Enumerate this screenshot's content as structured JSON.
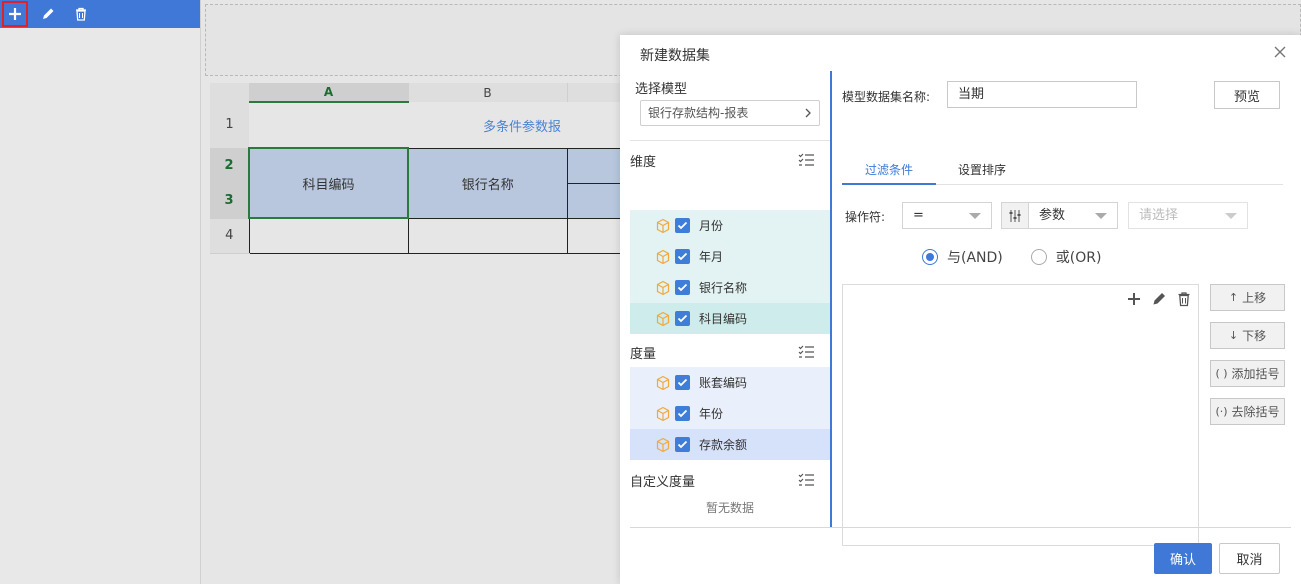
{
  "left_toolbar": {
    "add_icon": "plus-icon",
    "edit_icon": "pencil-icon",
    "delete_icon": "trash-icon"
  },
  "sheet": {
    "columns": [
      "A",
      "B"
    ],
    "rows": [
      "1",
      "2",
      "3",
      "4"
    ],
    "title": "多条件参数报",
    "header_cells": [
      "科目编码",
      "银行名称"
    ]
  },
  "dialog": {
    "title": "新建数据集",
    "left": {
      "model_label": "选择模型",
      "model_value": "银行存款结构-报表",
      "dimension_label": "维度",
      "dimensions": [
        "月份",
        "年月",
        "银行名称",
        "科目编码"
      ],
      "measure_label": "度量",
      "measures": [
        "账套编码",
        "年份",
        "存款余额"
      ],
      "custom_measure_label": "自定义度量",
      "empty_text": "暂无数据"
    },
    "right": {
      "name_label": "模型数据集名称:",
      "name_value": "当期",
      "preview_label": "预览",
      "tabs": [
        "过滤条件",
        "设置排序"
      ],
      "operator_label": "操作符:",
      "operator_value": "=",
      "param_value": "参数",
      "select_placeholder": "请选择",
      "radio_and": "与(AND)",
      "radio_or": "或(OR)",
      "move_up_label": "上移",
      "move_down_label": "下移",
      "add_bracket_label": "添加括号",
      "remove_bracket_label": "去除括号",
      "move_up_prefix": "↑",
      "move_down_prefix": "↓",
      "add_bracket_prefix": "( )",
      "remove_bracket_prefix": "(·)"
    },
    "ok_label": "确认",
    "cancel_label": "取消"
  },
  "colors": {
    "accent": "#3f78d7",
    "highlight_red": "#e0212b",
    "dimension_bg": "#e3f2f2",
    "measure_bg": "#eaf0fb",
    "cube_orange": "#f0a93a"
  }
}
